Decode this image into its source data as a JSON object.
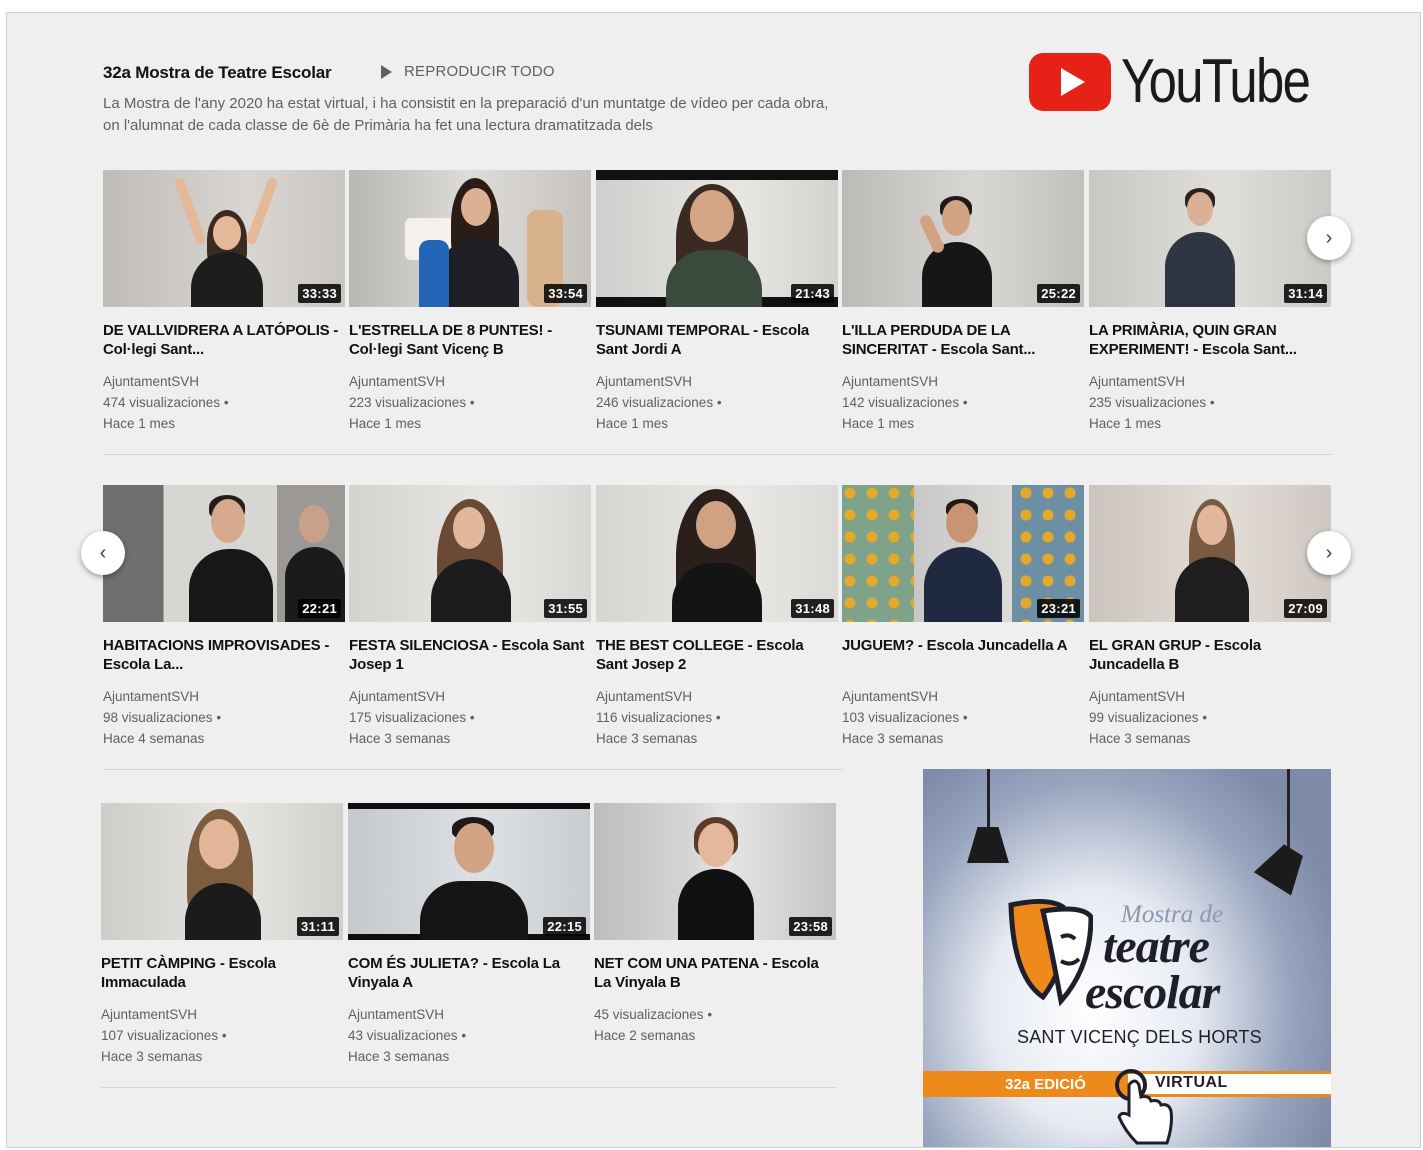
{
  "playlist": {
    "title": "32a Mostra de Teatre Escolar",
    "play_all": "REPRODUCIR TODO",
    "description": "La Mostra de l'any 2020 ha estat virtual, i ha consistit en la preparació d'un muntatge de vídeo per cada obra, on l'alumnat de cada classe de 6è de Primària ha fet una lectura dramatitzada dels"
  },
  "logo": {
    "word": "YouTube",
    "color": "#e62117"
  },
  "nav": {
    "next_glyph": "›",
    "prev_glyph": "‹"
  },
  "row1": [
    {
      "duration": "33:33",
      "title": "DE VALLVIDRERA A LATÓPOLIS - Col·legi Sant...",
      "channel": "AjuntamentSVH",
      "views": "474 visualizaciones •",
      "age": "Hace 1 mes"
    },
    {
      "duration": "33:54",
      "title": "L'ESTRELLA DE 8 PUNTES! - Col·legi Sant Vicenç B",
      "channel": "AjuntamentSVH",
      "views": "223 visualizaciones •",
      "age": "Hace 1 mes"
    },
    {
      "duration": "21:43",
      "title": "TSUNAMI TEMPORAL - Escola Sant Jordi A",
      "channel": "AjuntamentSVH",
      "views": "246 visualizaciones •",
      "age": "Hace 1 mes"
    },
    {
      "duration": "25:22",
      "title": "L'ILLA PERDUDA DE LA SINCERITAT - Escola Sant...",
      "channel": "AjuntamentSVH",
      "views": "142 visualizaciones •",
      "age": "Hace 1 mes"
    },
    {
      "duration": "31:14",
      "title": "LA PRIMÀRIA, QUIN GRAN EXPERIMENT! - Escola Sant...",
      "channel": "AjuntamentSVH",
      "views": "235 visualizaciones •",
      "age": "Hace 1 mes"
    }
  ],
  "row2": [
    {
      "duration": "22:21",
      "title": "HABITACIONS IMPROVISADES - Escola La...",
      "channel": "AjuntamentSVH",
      "views": "98 visualizaciones •",
      "age": "Hace 4 semanas"
    },
    {
      "duration": "31:55",
      "title": "FESTA SILENCIOSA - Escola Sant Josep 1",
      "channel": "AjuntamentSVH",
      "views": "175 visualizaciones •",
      "age": "Hace 3 semanas"
    },
    {
      "duration": "31:48",
      "title": "THE BEST COLLEGE - Escola Sant Josep 2",
      "channel": "AjuntamentSVH",
      "views": "116 visualizaciones •",
      "age": "Hace 3 semanas"
    },
    {
      "duration": "23:21",
      "title": "JUGUEM? - Escola Juncadella A",
      "channel": "AjuntamentSVH",
      "views": "103 visualizaciones •",
      "age": "Hace 3 semanas"
    },
    {
      "duration": "27:09",
      "title": "EL GRAN GRUP - Escola Juncadella B",
      "channel": "AjuntamentSVH",
      "views": "99 visualizaciones •",
      "age": "Hace 3 semanas"
    }
  ],
  "row3": [
    {
      "duration": "31:11",
      "title": "PETIT CÀMPING - Escola Immaculada",
      "channel": "AjuntamentSVH",
      "views": "107 visualizaciones •",
      "age": "Hace 3 semanas"
    },
    {
      "duration": "22:15",
      "title": "COM ÉS JULIETA? - Escola La Vinyala A",
      "channel": "AjuntamentSVH",
      "views": "43 visualizaciones •",
      "age": "Hace 3 semanas"
    },
    {
      "duration": "23:58",
      "title": "NET COM UNA PATENA - Escola La Vinyala B",
      "channel": "",
      "views": "45 visualizaciones •",
      "age": "Hace 2 semanas"
    }
  ],
  "poster": {
    "line1": "Mostra de",
    "line2": "teatre",
    "line3": "escolar",
    "place": "SANT VICENÇ DELS HORTS",
    "edition": "32a EDICIÓ",
    "mode": "VIRTUAL"
  }
}
